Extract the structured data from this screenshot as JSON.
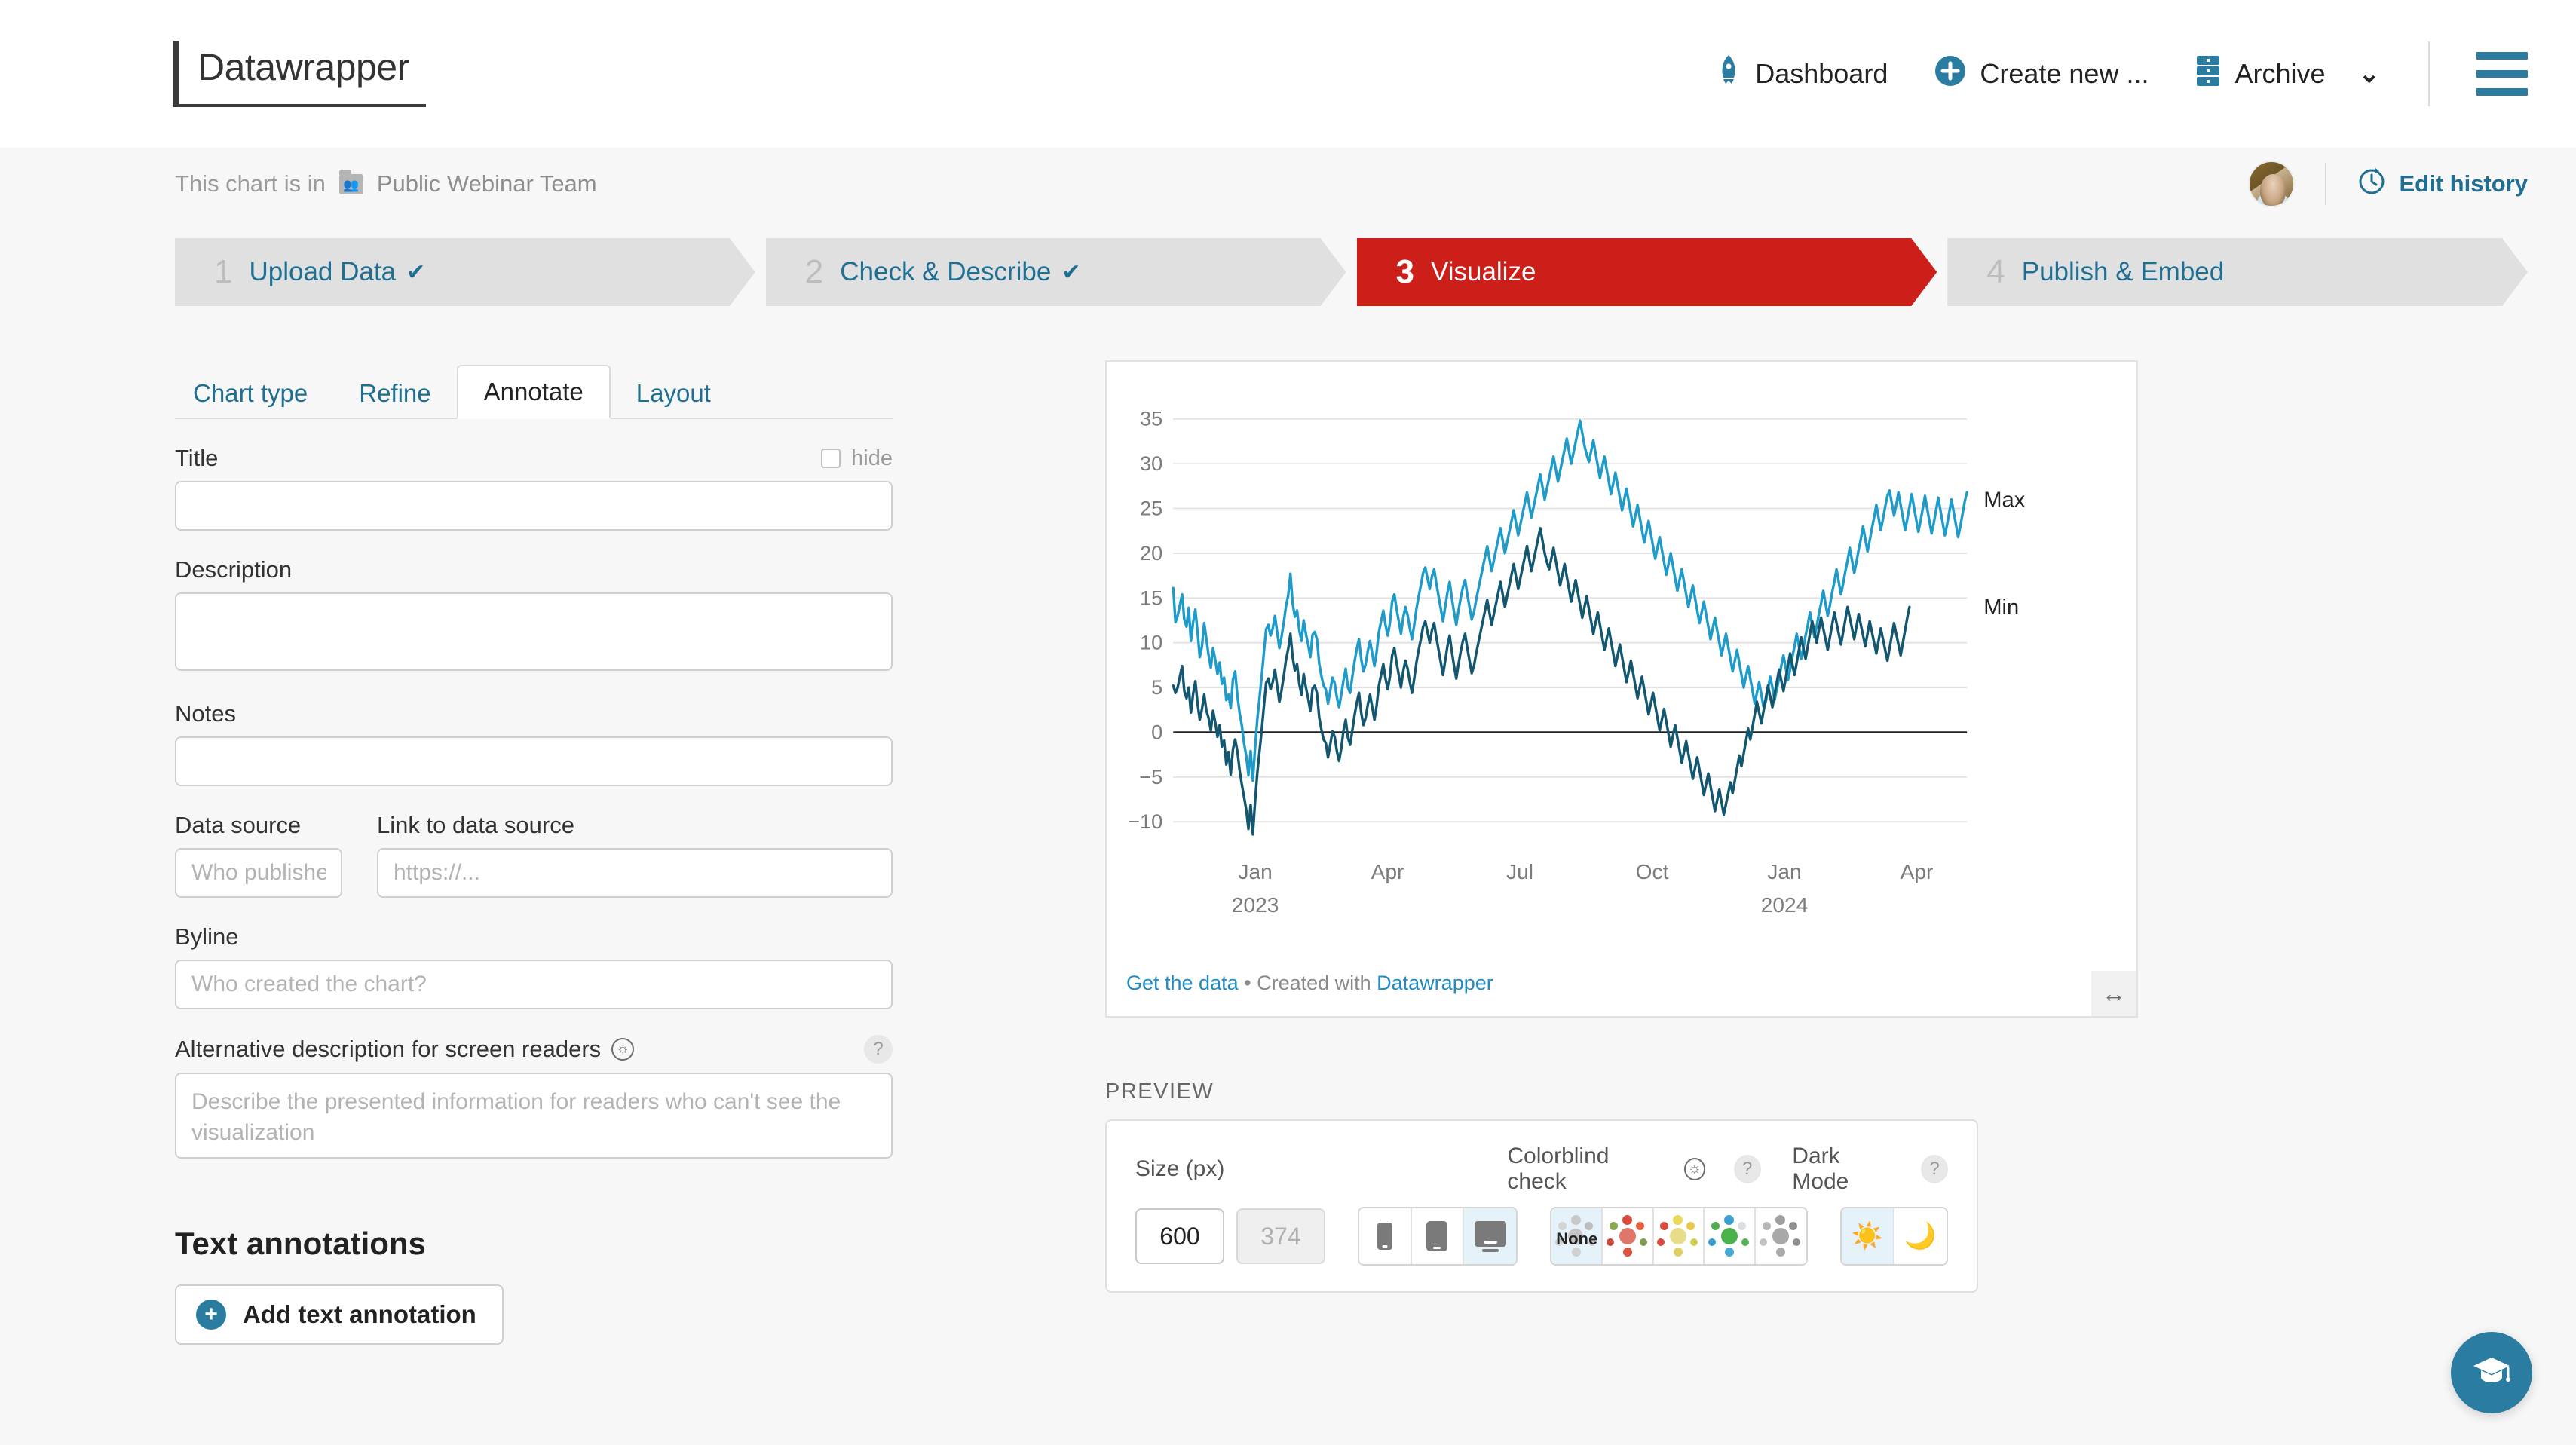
{
  "nav": {
    "brand": "Datawrapper",
    "items": [
      {
        "label": "Dashboard",
        "icon": "rocket-icon"
      },
      {
        "label": "Create new ...",
        "icon": "plus-circle-icon"
      },
      {
        "label": "Archive",
        "icon": "archive-drawer-icon"
      }
    ]
  },
  "teambar": {
    "prefix": "This chart is in",
    "team": "Public Webinar Team",
    "edit_history": "Edit history"
  },
  "steps": [
    {
      "num": "1",
      "label": "Upload Data",
      "check": "✔",
      "state": "done"
    },
    {
      "num": "2",
      "label": "Check & Describe",
      "check": "✔",
      "state": "done"
    },
    {
      "num": "3",
      "label": "Visualize",
      "check": "",
      "state": "active"
    },
    {
      "num": "4",
      "label": "Publish & Embed",
      "check": "",
      "state": "todo"
    }
  ],
  "tabs": [
    {
      "label": "Chart type",
      "active": false
    },
    {
      "label": "Refine",
      "active": false
    },
    {
      "label": "Annotate",
      "active": true
    },
    {
      "label": "Layout",
      "active": false
    }
  ],
  "form": {
    "title_label": "Title",
    "title_value": "",
    "title_placeholder": "",
    "hide_label": "hide",
    "description_label": "Description",
    "description_value": "",
    "description_placeholder": "",
    "notes_label": "Notes",
    "notes_value": "",
    "notes_placeholder": "",
    "data_source_label": "Data source",
    "data_source_placeholder": "Who published the data?",
    "link_label": "Link to data source",
    "link_placeholder": "https://...",
    "byline_label": "Byline",
    "byline_placeholder": "Who created the chart?",
    "alt_label": "Alternative description for screen readers",
    "alt_placeholder": "Describe the presented information for readers who can't see the visualization",
    "help_symbol": "?",
    "section_text_annotations": "Text annotations",
    "add_annotation": "Add text annotation"
  },
  "chart_footer": {
    "get_data": "Get the data",
    "separator": " • ",
    "created_with": "Created with ",
    "datawrapper": "Datawrapper"
  },
  "preview": {
    "title": "PREVIEW",
    "size_label": "Size (px)",
    "size_value": "600",
    "size_secondary": "374",
    "colorblind_label": "Colorblind check",
    "darkmode_label": "Dark Mode",
    "help_symbol": "?",
    "colorblind_none": "None",
    "devices": [
      {
        "name": "phone",
        "selected": false
      },
      {
        "name": "tablet",
        "selected": false
      },
      {
        "name": "desktop",
        "selected": true
      }
    ],
    "colorblind_options": [
      {
        "name": "none",
        "selected": true
      },
      {
        "name": "deuteranopia",
        "selected": false
      },
      {
        "name": "protanopia",
        "selected": false
      },
      {
        "name": "tritanopia",
        "selected": false
      },
      {
        "name": "achromatopsia",
        "selected": false
      }
    ],
    "darkmode_options": [
      {
        "name": "light",
        "selected": true
      },
      {
        "name": "dark",
        "selected": false
      }
    ]
  },
  "colors": {
    "accent_teal": "#2a7ca0",
    "link_teal": "#1f6f93",
    "active_step_red": "#cc1f1a",
    "series_max": "#1f9bc9",
    "series_min": "#13566f"
  },
  "chart_data": {
    "type": "line",
    "title": "",
    "xlabel": "",
    "ylabel": "",
    "ylim": [
      -12,
      37
    ],
    "yticks": [
      -10,
      -5,
      0,
      5,
      10,
      15,
      20,
      25,
      30,
      35
    ],
    "ytick_labels": [
      "−10",
      "−5",
      "0",
      "5",
      "10",
      "15",
      "20",
      "25",
      "30",
      "35"
    ],
    "xtick_labels": [
      "Jan",
      "Apr",
      "Jul",
      "Oct",
      "Jan",
      "Apr"
    ],
    "xtick_sublabels": [
      "2023",
      "",
      "",
      "",
      "2024",
      ""
    ],
    "grid": true,
    "zero_line": true,
    "legend_position": "right-inline",
    "series": [
      {
        "name": "Max",
        "color": "#1f9bc9",
        "label_value": 26.0,
        "values": [
          16.1,
          12.3,
          13.0,
          14.2,
          15.4,
          12.6,
          11.8,
          13.9,
          10.2,
          12.3,
          13.7,
          11.2,
          8.4,
          9.6,
          12.2,
          10.4,
          8.6,
          7.2,
          9.4,
          8.1,
          6.5,
          7.8,
          5.4,
          6.1,
          3.6,
          4.2,
          2.7,
          5.9,
          6.8,
          4.1,
          2.2,
          0.8,
          -1.2,
          -2.6,
          -4.8,
          -2.1,
          -5.4,
          -1.8,
          1.4,
          3.8,
          6.2,
          8.9,
          11.5,
          12.0,
          10.8,
          11.6,
          13.0,
          11.2,
          9.4,
          10.7,
          12.3,
          14.1,
          15.3,
          17.7,
          14.4,
          12.9,
          13.6,
          11.4,
          10.2,
          12.5,
          11.0,
          9.8,
          8.4,
          10.9,
          11.2,
          10.4,
          7.7,
          6.3,
          5.2,
          4.8,
          3.2,
          4.6,
          6.1,
          5.5,
          3.9,
          2.8,
          4.2,
          5.8,
          7.1,
          5.0,
          4.4,
          6.2,
          7.9,
          9.3,
          10.4,
          8.2,
          6.8,
          7.6,
          9.1,
          10.2,
          8.8,
          7.4,
          9.0,
          11.2,
          12.4,
          13.6,
          12.0,
          10.8,
          12.2,
          14.6,
          15.4,
          13.8,
          12.4,
          11.0,
          12.8,
          14.0,
          13.1,
          11.6,
          10.4,
          12.0,
          13.8,
          15.2,
          16.4,
          17.8,
          18.4,
          17.2,
          16.0,
          17.4,
          18.2,
          16.6,
          15.2,
          13.8,
          12.4,
          14.0,
          15.6,
          16.8,
          15.0,
          13.4,
          12.0,
          13.6,
          15.0,
          16.2,
          17.0,
          15.4,
          14.0,
          12.6,
          13.4,
          14.8,
          16.0,
          17.2,
          18.4,
          19.6,
          20.8,
          19.4,
          18.0,
          19.2,
          20.4,
          21.6,
          22.8,
          21.4,
          20.0,
          21.2,
          22.4,
          23.6,
          24.8,
          23.4,
          22.0,
          23.2,
          24.4,
          25.6,
          26.8,
          25.4,
          24.0,
          25.2,
          26.4,
          27.6,
          28.8,
          27.4,
          26.0,
          27.2,
          28.4,
          29.6,
          30.8,
          29.4,
          28.0,
          29.2,
          30.4,
          31.6,
          32.8,
          31.4,
          30.0,
          31.2,
          32.4,
          33.6,
          34.8,
          33.4,
          32.0,
          31.0,
          30.2,
          31.4,
          32.6,
          31.2,
          29.8,
          28.4,
          29.6,
          30.8,
          29.4,
          28.0,
          26.6,
          27.8,
          29.0,
          27.6,
          26.2,
          24.8,
          26.0,
          27.2,
          25.8,
          24.4,
          23.0,
          24.2,
          25.4,
          24.0,
          22.6,
          21.2,
          22.4,
          23.6,
          22.2,
          20.8,
          19.4,
          20.6,
          21.8,
          20.4,
          19.0,
          17.6,
          18.8,
          20.0,
          18.6,
          17.2,
          15.8,
          17.0,
          18.2,
          16.8,
          15.4,
          14.0,
          15.2,
          16.4,
          15.0,
          13.6,
          12.2,
          13.4,
          14.6,
          13.2,
          11.8,
          10.4,
          11.6,
          12.8,
          11.4,
          10.0,
          8.6,
          9.8,
          11.0,
          9.6,
          8.2,
          6.8,
          8.0,
          9.2,
          7.8,
          6.4,
          5.0,
          6.2,
          7.4,
          6.0,
          4.6,
          3.2,
          4.4,
          5.6,
          4.2,
          2.8,
          3.4,
          4.8,
          6.2,
          5.0,
          3.6,
          4.8,
          6.0,
          7.4,
          8.6,
          7.2,
          5.8,
          7.0,
          8.4,
          9.6,
          11.0,
          9.6,
          8.2,
          9.4,
          10.8,
          12.0,
          13.4,
          12.0,
          10.6,
          11.8,
          13.2,
          14.4,
          15.8,
          14.4,
          13.0,
          14.2,
          15.6,
          16.8,
          18.2,
          16.8,
          15.4,
          16.6,
          18.0,
          19.2,
          20.6,
          19.2,
          17.8,
          19.0,
          20.4,
          21.6,
          23.0,
          21.6,
          20.2,
          21.4,
          22.8,
          24.0,
          25.4,
          24.0,
          22.6,
          23.8,
          25.2,
          26.4,
          27.0,
          25.6,
          24.2,
          25.4,
          26.8,
          25.4,
          24.0,
          22.6,
          23.8,
          25.2,
          26.6,
          25.2,
          23.8,
          22.4,
          23.6,
          25.0,
          26.4,
          25.0,
          23.6,
          22.2,
          23.4,
          24.8,
          26.2,
          24.8,
          23.4,
          22.0,
          23.2,
          24.6,
          26.0,
          24.6,
          23.2,
          21.8,
          23.0,
          24.4,
          25.8,
          26.8
        ]
      },
      {
        "name": "Min",
        "color": "#13566f",
        "label_value": 14.0,
        "values": [
          5.2,
          4.4,
          5.0,
          6.2,
          7.4,
          4.6,
          3.8,
          5.0,
          2.2,
          4.3,
          5.7,
          3.2,
          1.4,
          2.6,
          4.2,
          2.4,
          1.6,
          0.2,
          2.4,
          1.1,
          -0.5,
          0.8,
          -1.6,
          -0.9,
          -3.6,
          -2.2,
          -4.7,
          -1.9,
          -0.8,
          -2.1,
          -4.2,
          -5.8,
          -7.2,
          -8.6,
          -10.8,
          -8.1,
          -11.4,
          -7.8,
          -4.6,
          -2.2,
          0.2,
          2.9,
          5.5,
          6.0,
          4.8,
          5.6,
          7.0,
          5.2,
          3.4,
          4.7,
          6.3,
          8.1,
          9.3,
          11.0,
          8.4,
          6.9,
          7.6,
          5.4,
          4.2,
          6.5,
          5.0,
          3.8,
          2.4,
          4.9,
          5.2,
          4.4,
          1.7,
          0.3,
          -0.8,
          -1.2,
          -2.8,
          -1.4,
          0.1,
          -0.5,
          -2.1,
          -3.2,
          -1.8,
          0.2,
          1.4,
          -0.6,
          -1.4,
          0.2,
          1.9,
          3.3,
          4.4,
          2.2,
          0.8,
          1.6,
          3.1,
          4.2,
          2.8,
          1.4,
          3.0,
          5.2,
          6.4,
          7.6,
          6.0,
          4.8,
          6.2,
          8.6,
          9.4,
          7.8,
          6.4,
          5.0,
          6.8,
          8.0,
          7.1,
          5.6,
          4.4,
          6.0,
          7.8,
          9.2,
          10.4,
          11.8,
          12.4,
          11.2,
          10.0,
          11.4,
          12.2,
          10.6,
          9.2,
          7.8,
          6.4,
          8.0,
          9.6,
          10.8,
          9.0,
          7.4,
          6.0,
          7.6,
          9.0,
          10.2,
          11.0,
          9.4,
          8.0,
          6.6,
          7.4,
          8.8,
          10.0,
          11.2,
          12.4,
          13.6,
          14.8,
          13.4,
          12.0,
          13.2,
          14.4,
          15.6,
          16.8,
          15.4,
          14.0,
          15.2,
          16.4,
          17.6,
          18.8,
          17.4,
          16.0,
          17.2,
          18.4,
          19.6,
          20.8,
          19.4,
          18.0,
          19.2,
          20.4,
          21.6,
          22.8,
          21.4,
          20.0,
          19.0,
          18.2,
          19.4,
          20.6,
          19.2,
          17.8,
          16.4,
          17.6,
          18.8,
          17.4,
          16.0,
          14.6,
          15.8,
          17.0,
          15.6,
          14.2,
          12.8,
          14.0,
          15.2,
          13.8,
          12.4,
          11.0,
          12.2,
          13.4,
          12.0,
          10.6,
          9.2,
          10.4,
          11.6,
          10.2,
          8.8,
          7.4,
          8.6,
          9.8,
          8.4,
          7.0,
          5.6,
          6.8,
          8.0,
          6.6,
          5.2,
          3.8,
          5.0,
          6.2,
          4.8,
          3.4,
          2.0,
          3.2,
          4.4,
          3.0,
          1.6,
          0.2,
          1.4,
          2.6,
          1.2,
          -0.2,
          -1.6,
          -0.4,
          0.8,
          -0.6,
          -2.0,
          -3.4,
          -2.2,
          -1.0,
          -2.4,
          -3.8,
          -5.2,
          -4.0,
          -2.8,
          -4.2,
          -5.6,
          -7.0,
          -5.8,
          -4.6,
          -6.0,
          -7.4,
          -8.8,
          -7.6,
          -6.4,
          -7.8,
          -9.2,
          -8.0,
          -6.8,
          -5.6,
          -6.8,
          -5.4,
          -4.0,
          -2.6,
          -3.8,
          -2.4,
          -1.0,
          0.4,
          -0.8,
          0.6,
          2.0,
          3.4,
          2.2,
          1.0,
          2.4,
          3.8,
          5.2,
          4.0,
          2.8,
          4.2,
          5.6,
          7.0,
          5.8,
          4.6,
          6.0,
          7.4,
          8.8,
          7.6,
          6.4,
          7.8,
          9.2,
          10.6,
          9.4,
          8.2,
          9.6,
          11.0,
          12.4,
          11.2,
          10.0,
          11.4,
          12.8,
          11.6,
          10.4,
          9.2,
          10.6,
          12.0,
          13.4,
          12.2,
          11.0,
          9.8,
          11.2,
          12.6,
          14.0,
          12.8,
          11.6,
          10.4,
          11.8,
          13.2,
          12.0,
          10.8,
          9.6,
          11.0,
          12.4,
          11.2,
          10.0,
          8.8,
          10.2,
          11.6,
          10.4,
          9.2,
          8.0,
          9.4,
          10.8,
          12.2,
          11.0,
          9.8,
          8.6,
          10.0,
          11.4,
          12.8,
          14.0
        ]
      }
    ]
  }
}
